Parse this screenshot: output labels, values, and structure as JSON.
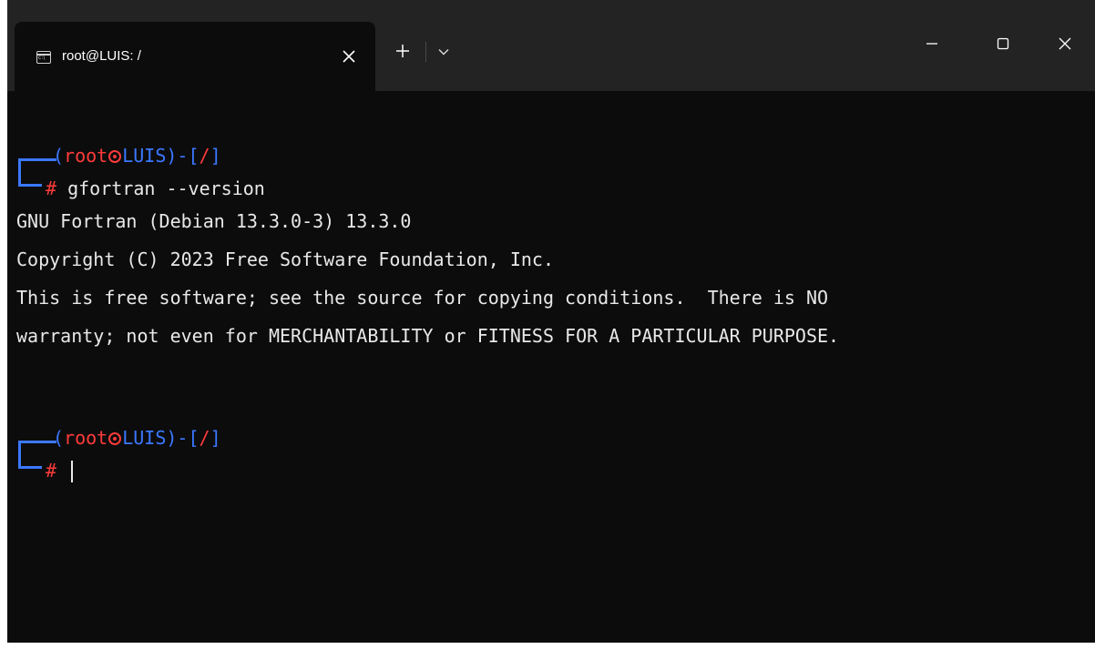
{
  "tab": {
    "title": "root@LUIS: /",
    "icon": "terminal-icon"
  },
  "titlebar": {
    "new_tab_icon": "plus-icon",
    "dropdown_icon": "chevron-down-icon",
    "minimize_icon": "minimize-icon",
    "maximize_icon": "maximize-icon",
    "close_icon": "close-icon"
  },
  "colors": {
    "background": "#0c0c0c",
    "titlebar": "#232323",
    "prompt_blue": "#3b78ff",
    "prompt_red": "#ff3b3b",
    "text": "#e8e8e8"
  },
  "terminal": {
    "prompt1": {
      "open": "(",
      "user": "root",
      "host": "LUIS",
      "close": ")-[",
      "path": "/",
      "end": "]",
      "symbol": "#",
      "command": " gfortran --version"
    },
    "output": [
      "GNU Fortran (Debian 13.3.0-3) 13.3.0",
      "Copyright (C) 2023 Free Software Foundation, Inc.",
      "This is free software; see the source for copying conditions.  There is NO",
      "warranty; not even for MERCHANTABILITY or FITNESS FOR A PARTICULAR PURPOSE."
    ],
    "prompt2": {
      "open": "(",
      "user": "root",
      "host": "LUIS",
      "close": ")-[",
      "path": "/",
      "end": "]",
      "symbol": "#"
    }
  }
}
